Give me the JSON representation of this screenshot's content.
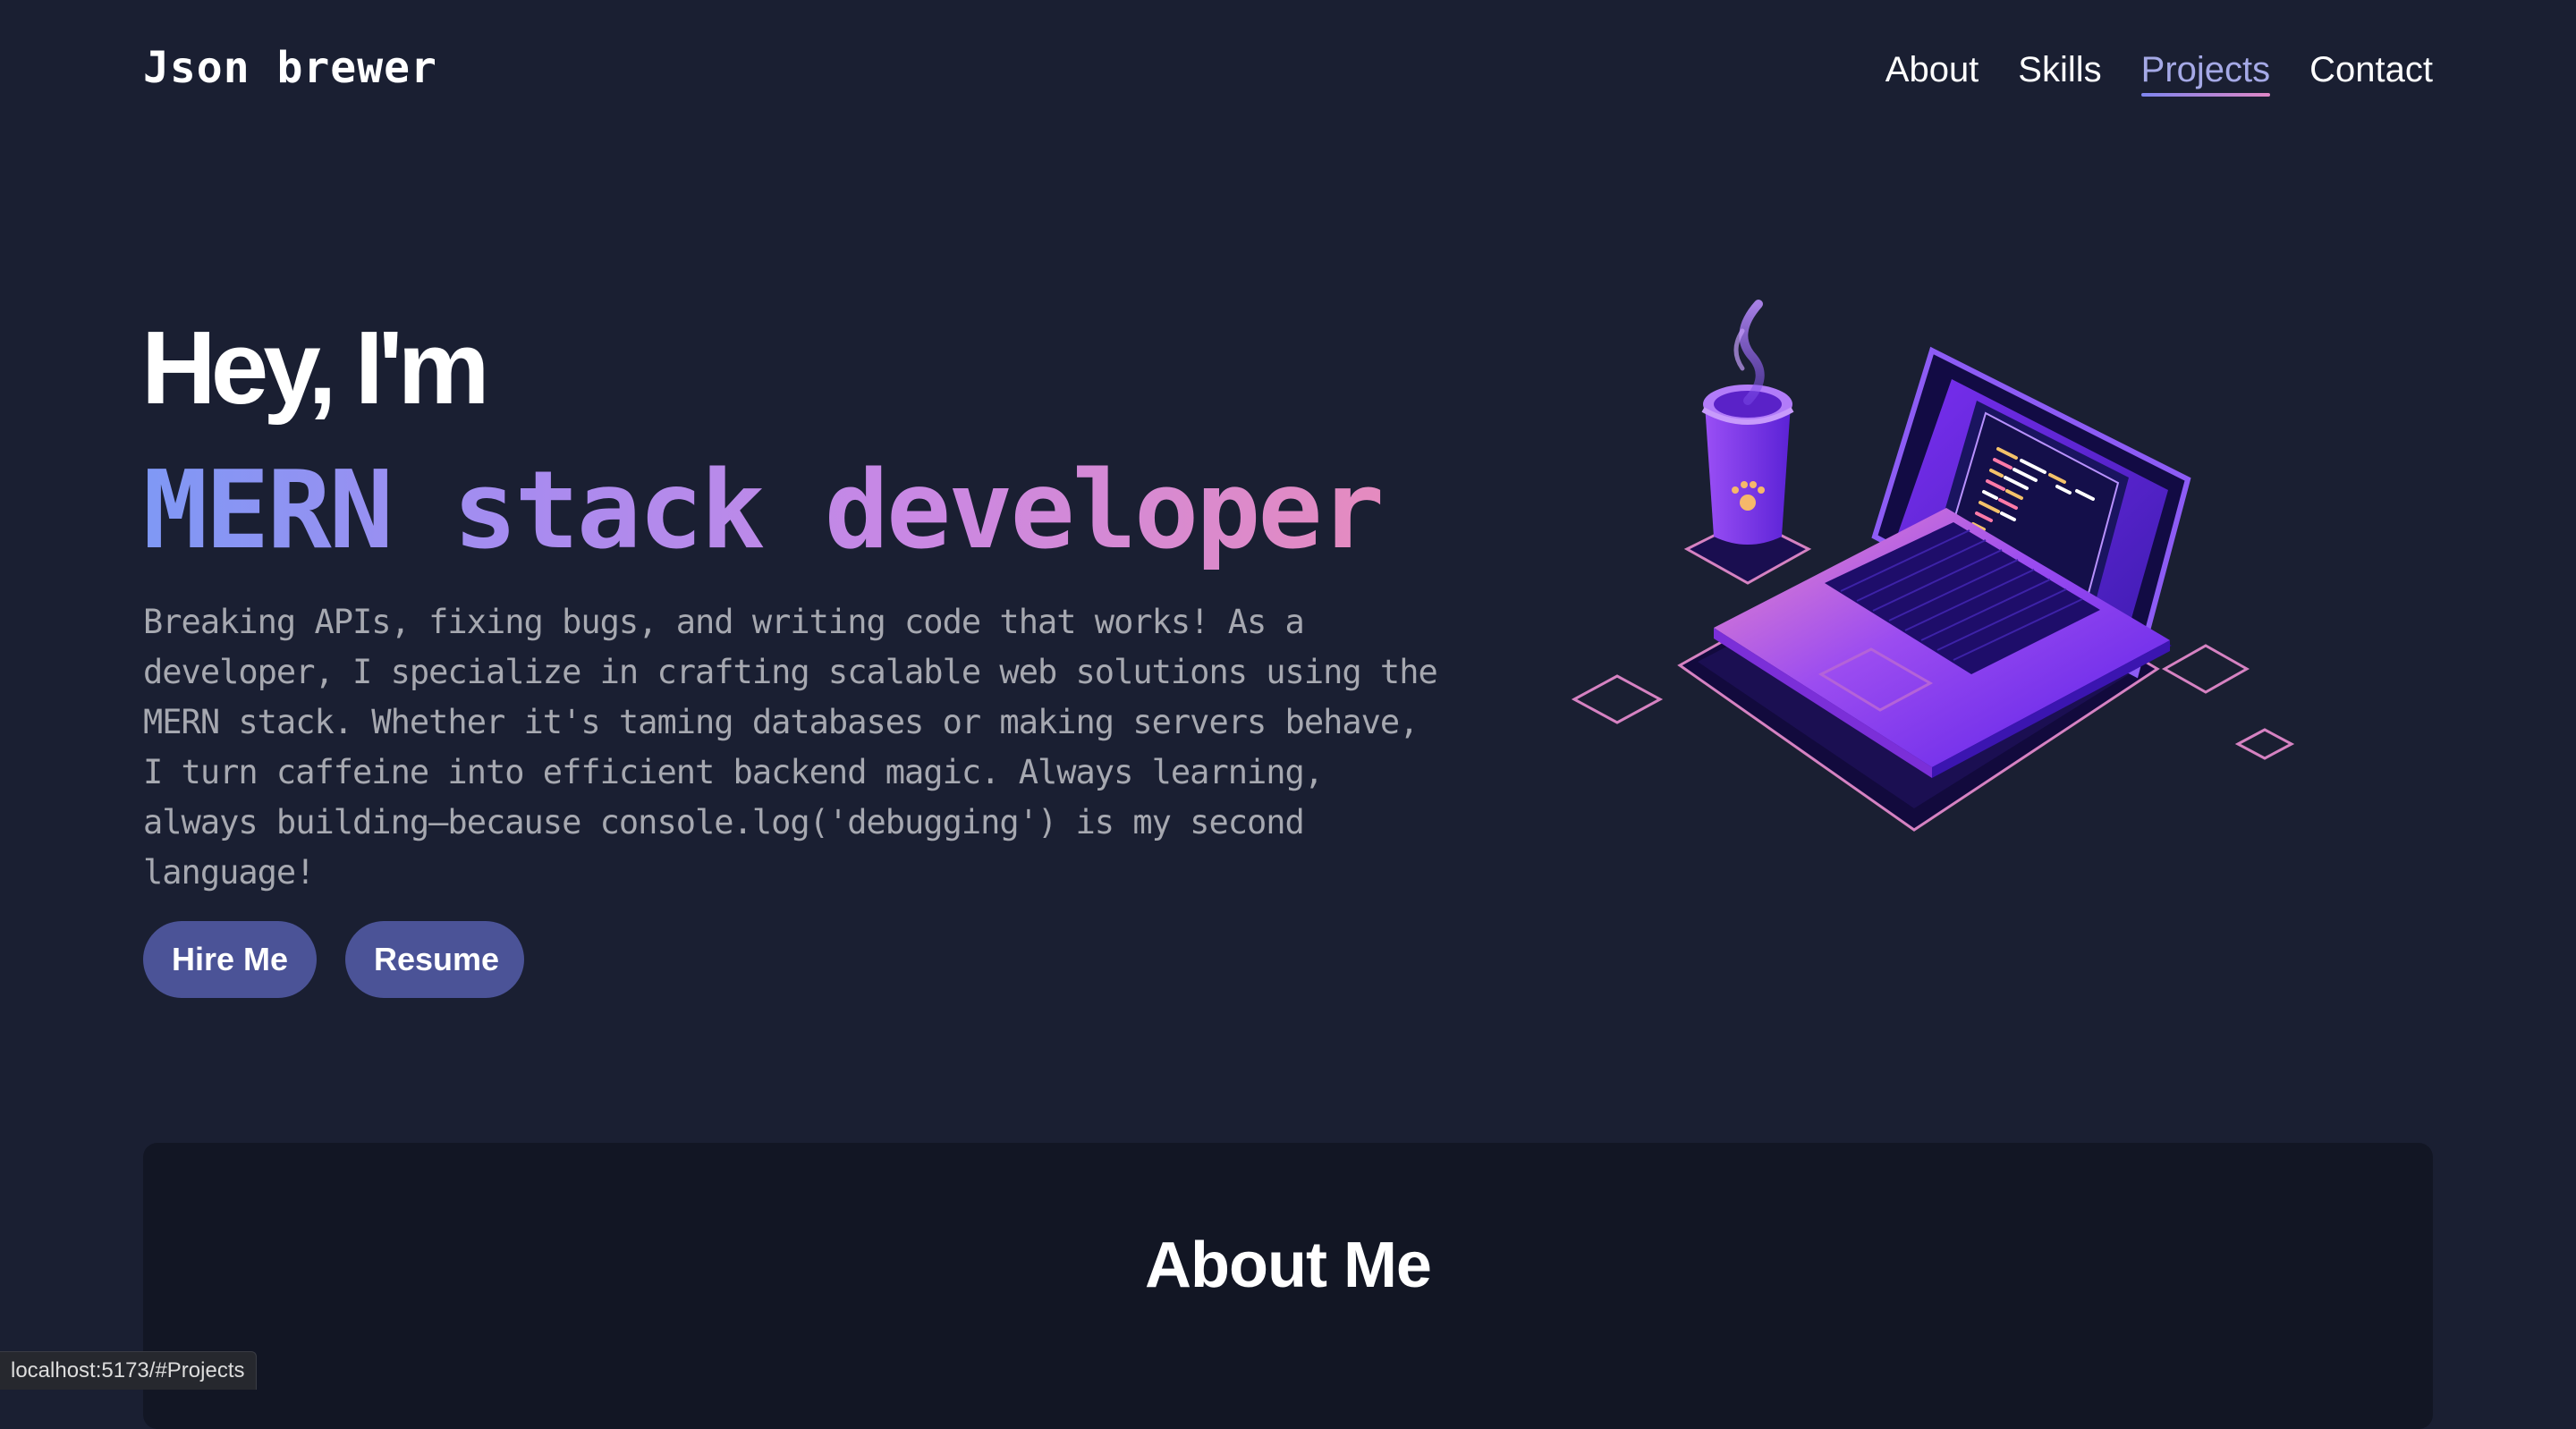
{
  "header": {
    "logo": "Json brewer",
    "nav": [
      {
        "label": "About"
      },
      {
        "label": "Skills"
      },
      {
        "label": "Projects",
        "active": true
      },
      {
        "label": "Contact"
      }
    ]
  },
  "hero": {
    "greeting": "Hey, I'm",
    "role": "MERN stack developer",
    "description": "Breaking APIs, fixing bugs, and writing code that works! As a developer, I specialize in crafting scalable web solutions using the MERN stack. Whether it's taming databases or making servers behave, I turn caffeine into efficient backend magic. Always learning, always building—because console.log('debugging') is my second language!",
    "buttons": {
      "hire": "Hire Me",
      "resume": "Resume"
    },
    "illustration": "laptop-and-coffee-illustration"
  },
  "about": {
    "title": "About Me"
  },
  "status_bar": {
    "url": "localhost:5173/#Projects"
  },
  "colors": {
    "background": "#1a1f32",
    "card": "#121624",
    "button": "#4b5397",
    "accent_start": "#7f98f5",
    "accent_end": "#e58bbf",
    "active_nav": "#a5a9e6"
  }
}
